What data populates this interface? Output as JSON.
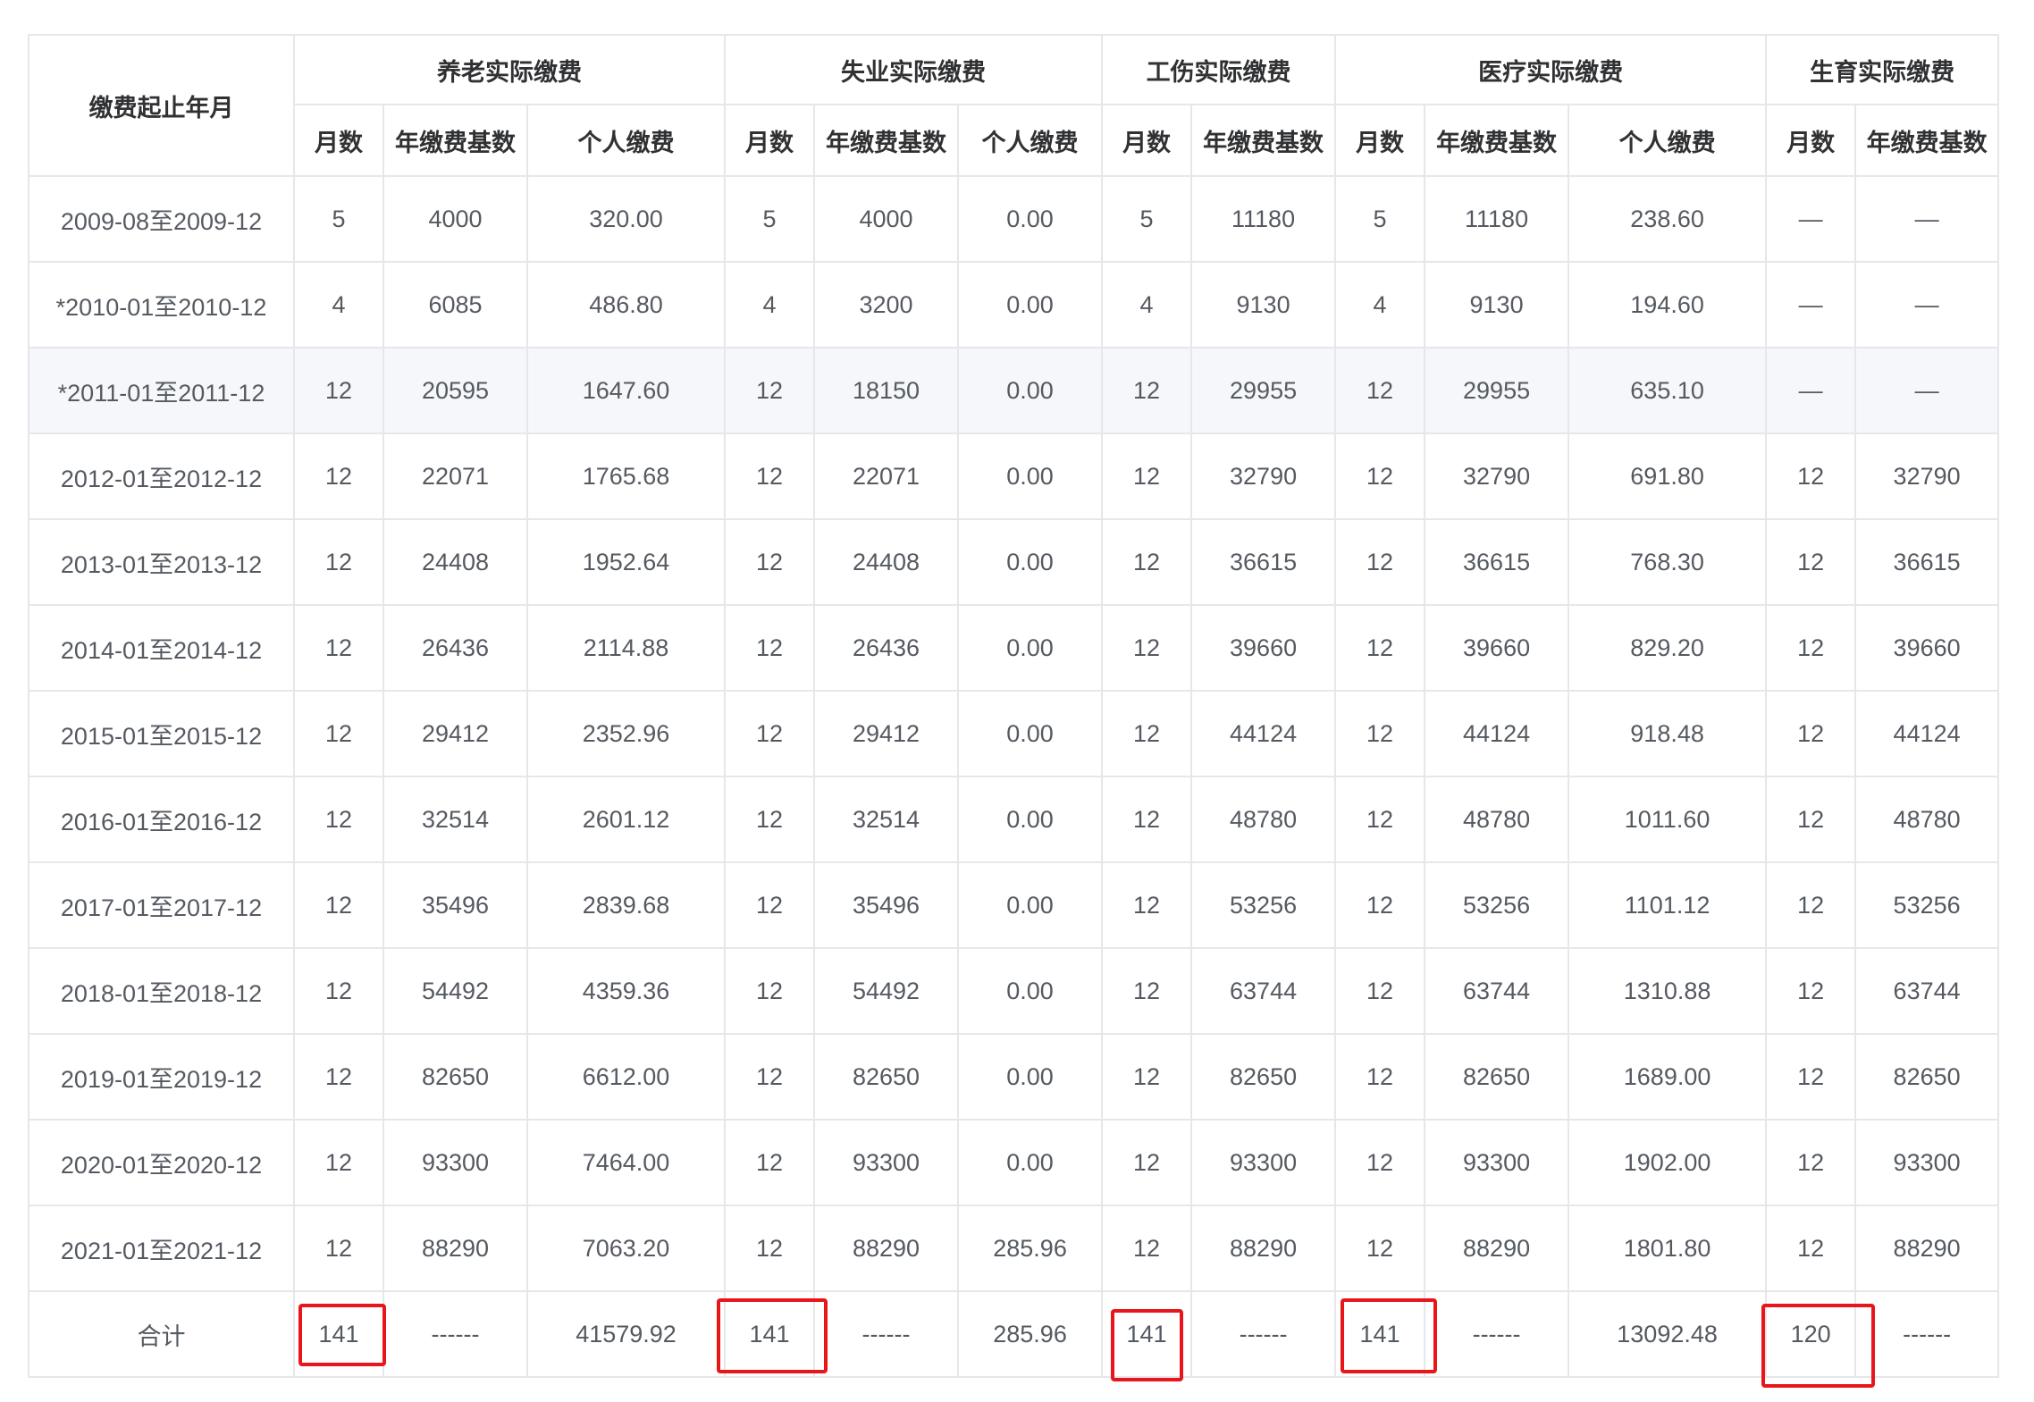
{
  "header": {
    "period": "缴费起止年月",
    "groups": [
      "养老实际缴费",
      "失业实际缴费",
      "工伤实际缴费",
      "医疗实际缴费",
      "生育实际缴费"
    ],
    "subs": [
      "月数",
      "年缴费基数",
      "个人缴费",
      "月数",
      "年缴费基数",
      "个人缴费",
      "月数",
      "年缴费基数",
      "月数",
      "年缴费基数",
      "个人缴费",
      "月数",
      "年缴费基数"
    ]
  },
  "rows": [
    [
      "2009-08至2009-12",
      "5",
      "4000",
      "320.00",
      "5",
      "4000",
      "0.00",
      "5",
      "11180",
      "5",
      "11180",
      "238.60",
      "—",
      "—"
    ],
    [
      "*2010-01至2010-12",
      "4",
      "6085",
      "486.80",
      "4",
      "3200",
      "0.00",
      "4",
      "9130",
      "4",
      "9130",
      "194.60",
      "—",
      "—"
    ],
    [
      "*2011-01至2011-12",
      "12",
      "20595",
      "1647.60",
      "12",
      "18150",
      "0.00",
      "12",
      "29955",
      "12",
      "29955",
      "635.10",
      "—",
      "—"
    ],
    [
      "2012-01至2012-12",
      "12",
      "22071",
      "1765.68",
      "12",
      "22071",
      "0.00",
      "12",
      "32790",
      "12",
      "32790",
      "691.80",
      "12",
      "32790"
    ],
    [
      "2013-01至2013-12",
      "12",
      "24408",
      "1952.64",
      "12",
      "24408",
      "0.00",
      "12",
      "36615",
      "12",
      "36615",
      "768.30",
      "12",
      "36615"
    ],
    [
      "2014-01至2014-12",
      "12",
      "26436",
      "2114.88",
      "12",
      "26436",
      "0.00",
      "12",
      "39660",
      "12",
      "39660",
      "829.20",
      "12",
      "39660"
    ],
    [
      "2015-01至2015-12",
      "12",
      "29412",
      "2352.96",
      "12",
      "29412",
      "0.00",
      "12",
      "44124",
      "12",
      "44124",
      "918.48",
      "12",
      "44124"
    ],
    [
      "2016-01至2016-12",
      "12",
      "32514",
      "2601.12",
      "12",
      "32514",
      "0.00",
      "12",
      "48780",
      "12",
      "48780",
      "1011.60",
      "12",
      "48780"
    ],
    [
      "2017-01至2017-12",
      "12",
      "35496",
      "2839.68",
      "12",
      "35496",
      "0.00",
      "12",
      "53256",
      "12",
      "53256",
      "1101.12",
      "12",
      "53256"
    ],
    [
      "2018-01至2018-12",
      "12",
      "54492",
      "4359.36",
      "12",
      "54492",
      "0.00",
      "12",
      "63744",
      "12",
      "63744",
      "1310.88",
      "12",
      "63744"
    ],
    [
      "2019-01至2019-12",
      "12",
      "82650",
      "6612.00",
      "12",
      "82650",
      "0.00",
      "12",
      "82650",
      "12",
      "82650",
      "1689.00",
      "12",
      "82650"
    ],
    [
      "2020-01至2020-12",
      "12",
      "93300",
      "7464.00",
      "12",
      "93300",
      "0.00",
      "12",
      "93300",
      "12",
      "93300",
      "1902.00",
      "12",
      "93300"
    ],
    [
      "2021-01至2021-12",
      "12",
      "88290",
      "7063.20",
      "12",
      "88290",
      "285.96",
      "12",
      "88290",
      "12",
      "88290",
      "1801.80",
      "12",
      "88290"
    ],
    [
      "合计",
      "141",
      "------",
      "41579.92",
      "141",
      "------",
      "285.96",
      "141",
      "------",
      "141",
      "------",
      "13092.48",
      "120",
      "------"
    ]
  ]
}
